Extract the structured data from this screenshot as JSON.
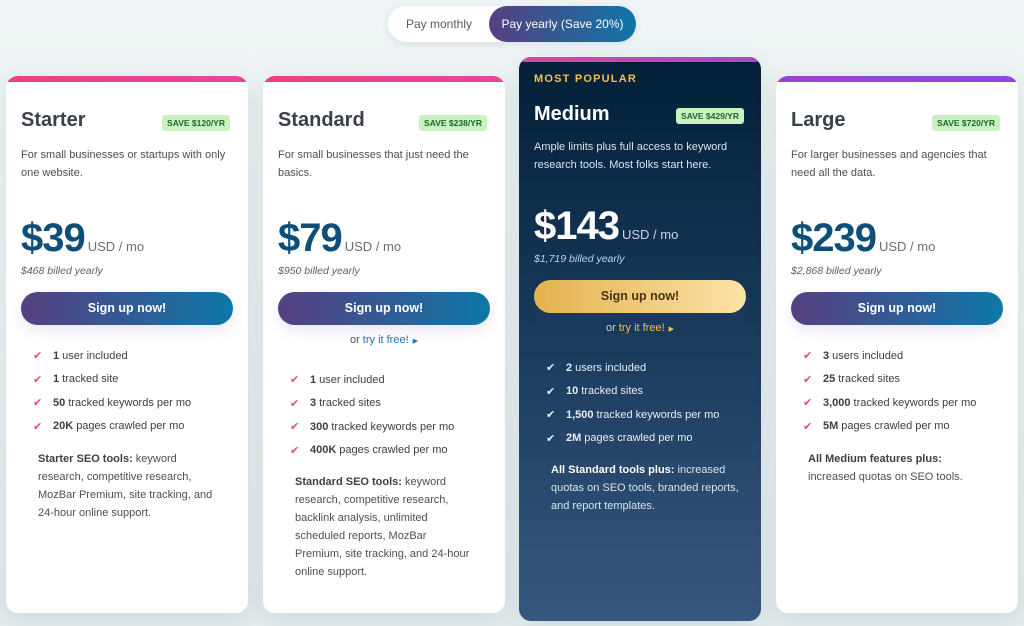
{
  "billing_toggle": {
    "monthly_label": "Pay monthly",
    "yearly_label": "Pay yearly (Save 20%)",
    "selected": "yearly"
  },
  "colors": {
    "primary_gradient_start": "#573f80",
    "primary_gradient_end": "#0e77a8",
    "check_color": "#e8467c",
    "gold": "#f0c050",
    "save_badge_bg": "#c9f2c1"
  },
  "plans": [
    {
      "name": "Starter",
      "save_badge": "SAVE $120/YR",
      "description": "For small businesses or startups with only one website.",
      "price": "$39",
      "per": "USD / mo",
      "billed": "$468 billed yearly",
      "cta": "Sign up now!",
      "features": [
        {
          "bold": "1",
          "text": "user included"
        },
        {
          "bold": "1",
          "text": "tracked site"
        },
        {
          "bold": "50",
          "text": "tracked keywords per mo"
        },
        {
          "bold": "20K",
          "text": "pages crawled per mo"
        }
      ],
      "tools_title": "Starter SEO tools:",
      "tools_text": " keyword research, competitive research, MozBar Premium, site tracking, and 24-hour online support."
    },
    {
      "name": "Standard",
      "save_badge": "SAVE $238/YR",
      "description": "For small businesses that just need the basics.",
      "price": "$79",
      "per": "USD / mo",
      "billed": "$950 billed yearly",
      "cta": "Sign up now!",
      "try_prefix": "or ",
      "try_link": "try it free!",
      "features": [
        {
          "bold": "1",
          "text": "user included"
        },
        {
          "bold": "3",
          "text": "tracked sites"
        },
        {
          "bold": "300",
          "text": "tracked keywords per mo"
        },
        {
          "bold": "400K",
          "text": "pages crawled per mo"
        }
      ],
      "tools_title": "Standard SEO tools:",
      "tools_text": " keyword research, competitive research, backlink analysis, unlimited scheduled reports, MozBar Premium, site tracking, and 24-hour online support."
    },
    {
      "ribbon": "MOST POPULAR",
      "name": "Medium",
      "save_badge": "SAVE $429/YR",
      "description": "Ample limits plus full access to keyword research tools. Most folks start here.",
      "price": "$143",
      "per": "USD / mo",
      "billed": "$1,719 billed yearly",
      "cta": "Sign up now!",
      "try_prefix": "or ",
      "try_link": "try it free!",
      "features": [
        {
          "bold": "2",
          "text": "users included"
        },
        {
          "bold": "10",
          "text": "tracked sites"
        },
        {
          "bold": "1,500",
          "text": "tracked keywords per mo"
        },
        {
          "bold": "2M",
          "text": "pages crawled per mo"
        }
      ],
      "tools_title": "All Standard tools plus:",
      "tools_text": " increased quotas on SEO tools, branded reports, and report templates."
    },
    {
      "name": "Large",
      "save_badge": "SAVE $720/YR",
      "description": "For larger businesses and agencies that need all the data.",
      "price": "$239",
      "per": "USD / mo",
      "billed": "$2,868 billed yearly",
      "cta": "Sign up now!",
      "features": [
        {
          "bold": "3",
          "text": "users included"
        },
        {
          "bold": "25",
          "text": "tracked sites"
        },
        {
          "bold": "3,000",
          "text": "tracked keywords per mo"
        },
        {
          "bold": "5M",
          "text": "pages crawled per mo"
        }
      ],
      "tools_title": "All Medium features plus:",
      "tools_text": " increased quotas on SEO tools."
    }
  ]
}
